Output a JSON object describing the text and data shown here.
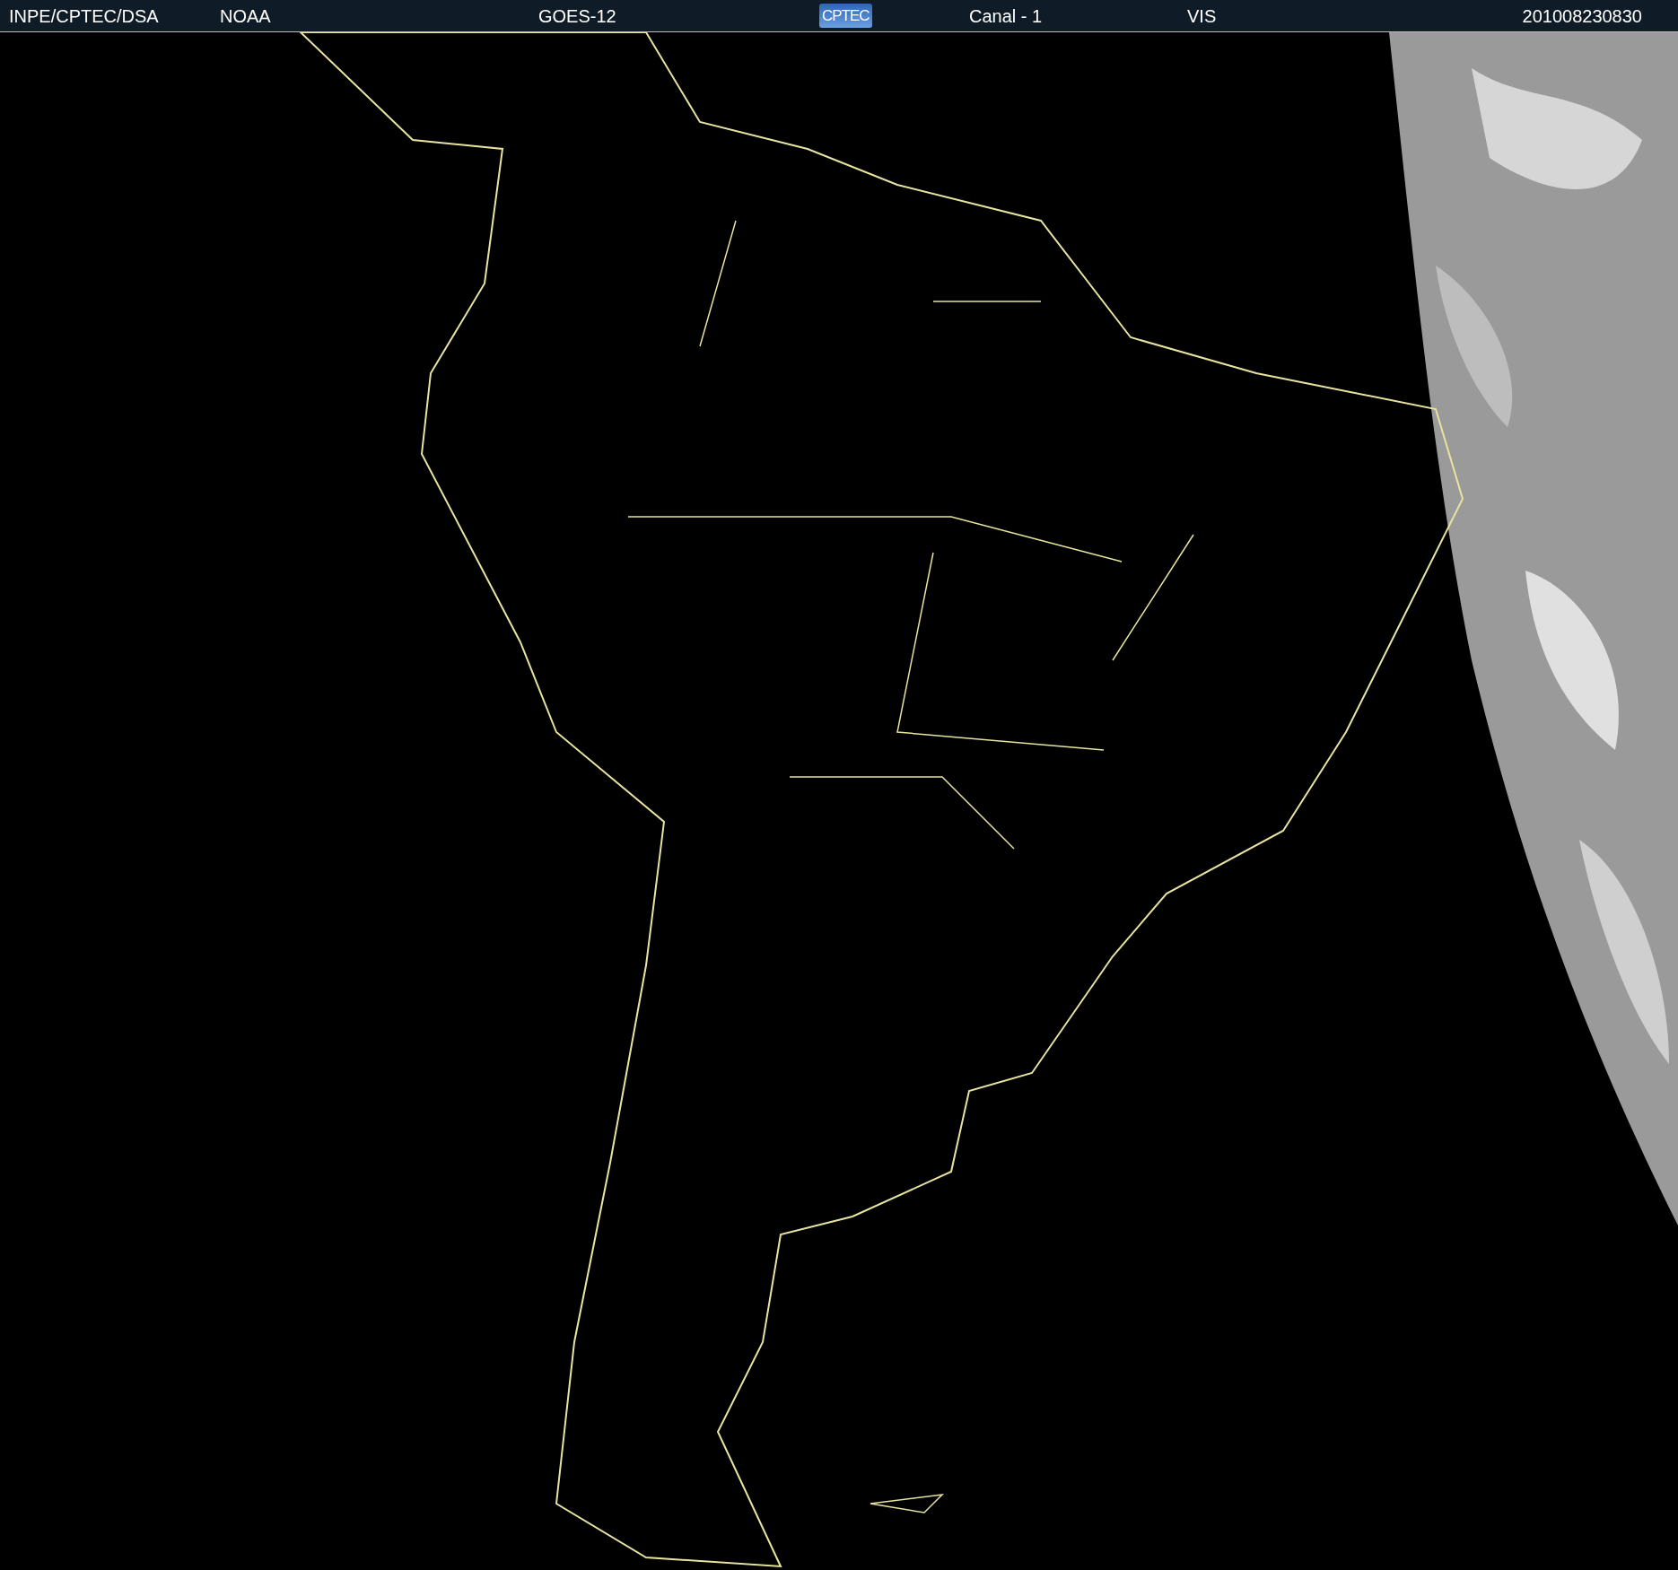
{
  "header": {
    "source": "INPE/CPTEC/DSA",
    "agency": "NOAA",
    "satellite": "GOES-12",
    "logo": "CPTEC",
    "channel": "Canal - 1",
    "band": "VIS",
    "timestamp": "201008230830"
  }
}
